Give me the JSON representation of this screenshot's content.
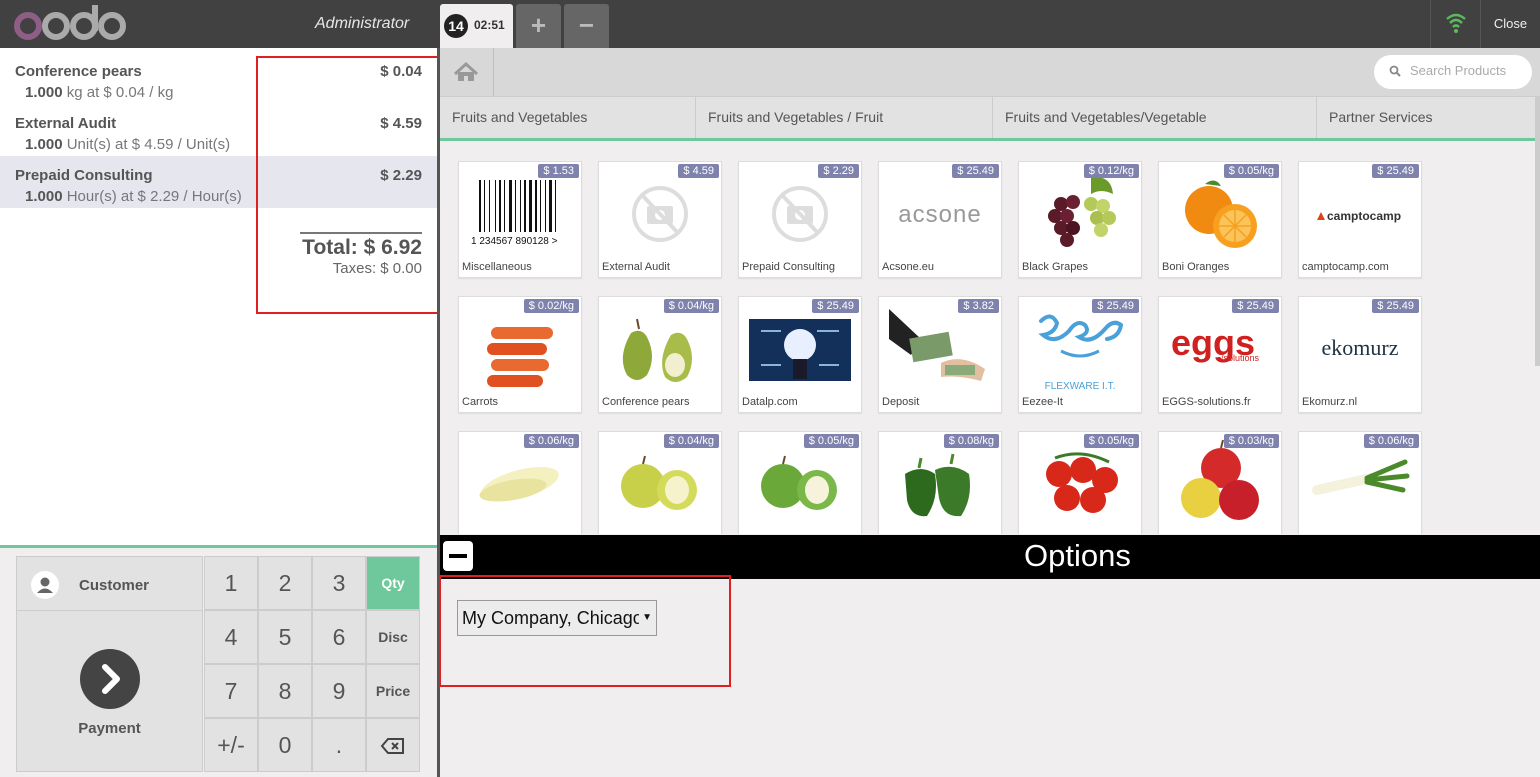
{
  "header": {
    "logo_text": "odoo",
    "user": "Administrator",
    "order_number": "14",
    "order_time": "02:51",
    "add_order_icon": "plus-icon",
    "delete_order_icon": "minus-icon",
    "connection_icon": "wifi-icon",
    "close_label": "Close"
  },
  "order": {
    "lines": [
      {
        "name": "Conference pears",
        "price": "$ 0.04",
        "qty": "1.000",
        "info": " kg at $ 0.04 / kg"
      },
      {
        "name": "External Audit",
        "price": "$ 4.59",
        "qty": "1.000",
        "info": " Unit(s) at $ 4.59 / Unit(s)"
      },
      {
        "name": "Prepaid Consulting",
        "price": "$ 2.29",
        "qty": "1.000",
        "info": " Hour(s) at $ 2.29 / Hour(s)"
      }
    ],
    "total": "Total: $ 6.92",
    "taxes": "Taxes: $ 0.00"
  },
  "actionpad": {
    "customer_label": "Customer",
    "payment_label": "Payment"
  },
  "numpad": {
    "keys": [
      "1",
      "2",
      "3",
      "Qty",
      "4",
      "5",
      "6",
      "Disc",
      "7",
      "8",
      "9",
      "Price",
      "+/-",
      "0",
      "."
    ],
    "backspace_icon": "backspace-icon",
    "active_mode": "Qty"
  },
  "search": {
    "placeholder": "Search Products"
  },
  "categories": [
    "Fruits and Vegetables",
    "Fruits and Vegetables / Fruit",
    "Fruits and Vegetables/Vegetable",
    "Partner Services"
  ],
  "products": [
    {
      "name": "Miscellaneous",
      "price": "$ 1.53",
      "icon": "barcode"
    },
    {
      "name": "External Audit",
      "price": "$ 4.59",
      "icon": "no-photo"
    },
    {
      "name": "Prepaid Consulting",
      "price": "$ 2.29",
      "icon": "no-photo"
    },
    {
      "name": "Acsone.eu",
      "price": "$ 25.49",
      "icon": "acsone-logo"
    },
    {
      "name": "Black Grapes",
      "price": "$ 0.12/kg",
      "icon": "grapes"
    },
    {
      "name": "Boni Oranges",
      "price": "$ 0.05/kg",
      "icon": "oranges"
    },
    {
      "name": "camptocamp.com",
      "price": "$ 25.49",
      "icon": "camptocamp-logo"
    },
    {
      "name": "Carrots",
      "price": "$ 0.02/kg",
      "icon": "carrots"
    },
    {
      "name": "Conference pears",
      "price": "$ 0.04/kg",
      "icon": "pears"
    },
    {
      "name": "Datalp.com",
      "price": "$ 25.49",
      "icon": "datalp"
    },
    {
      "name": "Deposit",
      "price": "$ 3.82",
      "icon": "cash"
    },
    {
      "name": "Eezee-It",
      "price": "$ 25.49",
      "icon": "eezee-logo"
    },
    {
      "name": "EGGS-solutions.fr",
      "price": "$ 25.49",
      "icon": "eggs-logo"
    },
    {
      "name": "Ekomurz.nl",
      "price": "$ 25.49",
      "icon": "ekomurz-logo"
    },
    {
      "name": "",
      "price": "$ 0.06/kg",
      "icon": "endive"
    },
    {
      "name": "",
      "price": "$ 0.04/kg",
      "icon": "golden-apples"
    },
    {
      "name": "",
      "price": "$ 0.05/kg",
      "icon": "green-apples"
    },
    {
      "name": "",
      "price": "$ 0.08/kg",
      "icon": "green-peppers"
    },
    {
      "name": "",
      "price": "$ 0.05/kg",
      "icon": "tomatoes"
    },
    {
      "name": "",
      "price": "$ 0.03/kg",
      "icon": "red-apples"
    },
    {
      "name": "",
      "price": "$ 0.06/kg",
      "icon": "leeks"
    }
  ],
  "logo_text": {
    "acsone": "acsone",
    "camptocamp": "camptocamp",
    "eezee_sub": "FLEXWARE I.T.",
    "eggs": "eggs",
    "eggs_sub": "/solutions",
    "ekomurz": "ekomurz",
    "barcode_digits": "1 234567 890128 >"
  },
  "options": {
    "title": "Options",
    "company_selected": "My Company, Chicago"
  },
  "colors": {
    "accent": "#6ec89b",
    "price_tag": "#7f82ac",
    "topbar": "#414141",
    "highlight_box": "#e02020"
  }
}
